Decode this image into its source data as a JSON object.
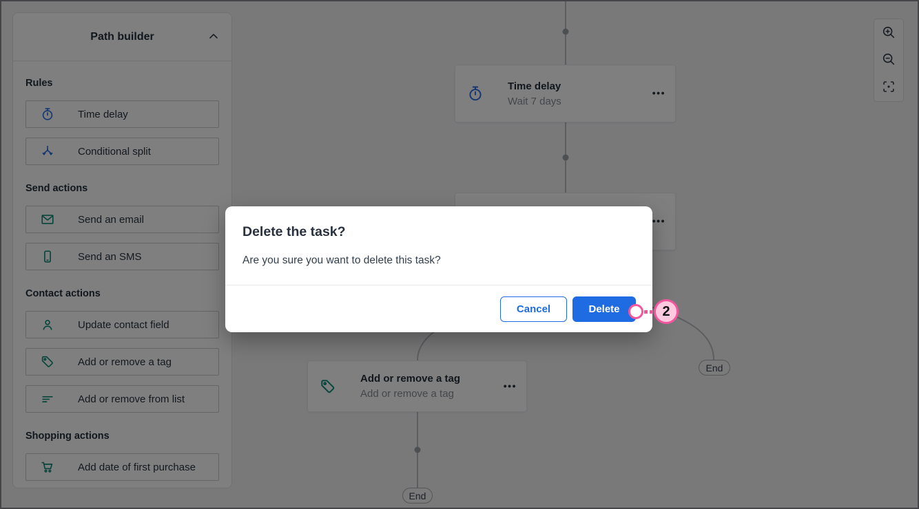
{
  "sidebar": {
    "title": "Path builder",
    "sections": [
      {
        "label": "Rules",
        "items": [
          {
            "label": "Time delay",
            "icon": "stopwatch-icon",
            "color": "#2b6ce2"
          },
          {
            "label": "Conditional split",
            "icon": "split-icon",
            "color": "#2b6ce2"
          }
        ]
      },
      {
        "label": "Send actions",
        "items": [
          {
            "label": "Send an email",
            "icon": "email-icon",
            "color": "#0f8a78"
          },
          {
            "label": "Send an SMS",
            "icon": "phone-icon",
            "color": "#0f8a78"
          }
        ]
      },
      {
        "label": "Contact actions",
        "items": [
          {
            "label": "Update contact field",
            "icon": "person-icon",
            "color": "#0f8a78"
          },
          {
            "label": "Add or remove a tag",
            "icon": "tag-icon",
            "color": "#0f8a78"
          },
          {
            "label": "Add or remove from list",
            "icon": "list-icon",
            "color": "#0f8a78"
          }
        ]
      },
      {
        "label": "Shopping actions",
        "items": [
          {
            "label": "Add date of first purchase",
            "icon": "cart-icon",
            "color": "#0f8a78"
          }
        ]
      }
    ]
  },
  "canvas": {
    "nodes": [
      {
        "title": "Time delay",
        "subtitle": "Wait 7 days",
        "icon": "stopwatch-icon",
        "menu_icon": "more-ellipsis"
      },
      {
        "title": "",
        "subtitle": "",
        "icon": "",
        "menu_icon": "more-ellipsis",
        "note": "partially hidden behind modal"
      },
      {
        "title": "Add or remove a tag",
        "subtitle": "Add or remove a tag",
        "icon": "tag-icon",
        "menu_icon": "more-ellipsis"
      }
    ],
    "end_labels": [
      "End",
      "End"
    ]
  },
  "zoom_toolbar": {
    "buttons": [
      {
        "icon": "zoom-in-icon"
      },
      {
        "icon": "zoom-out-icon"
      },
      {
        "icon": "fit-screen-icon"
      }
    ]
  },
  "modal": {
    "title": "Delete the task?",
    "body": "Are you sure you want to delete this task?",
    "cancel_label": "Cancel",
    "delete_label": "Delete"
  },
  "annotation": {
    "step_number": "2"
  },
  "colors": {
    "accent_blue": "#1f6be2",
    "icon_teal": "#0f8a78",
    "annotation_pink": "#f4569e",
    "annotation_pink_light": "#ffc9df",
    "overlay": "rgba(0,0,0,0.5)"
  }
}
